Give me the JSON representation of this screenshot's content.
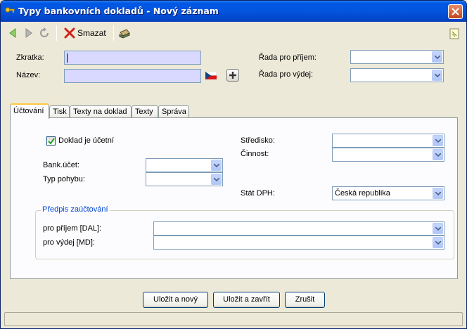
{
  "window": {
    "title": "Typy bankovních dokladů - Nový záznam"
  },
  "toolbar": {
    "delete_label": "Smazat"
  },
  "form": {
    "zkratka_label": "Zkratka:",
    "nazev_label": "Název:",
    "rada_prijem_label": "Řada pro příjem:",
    "rada_vydej_label": "Řada pro výdej:",
    "zkratka_value": "",
    "nazev_value": "",
    "rada_prijem_value": "",
    "rada_vydej_value": ""
  },
  "tabs": [
    {
      "label": "Účtování",
      "active": true
    },
    {
      "label": "Tisk"
    },
    {
      "label": "Texty na doklad"
    },
    {
      "label": "Texty"
    },
    {
      "label": "Správa"
    }
  ],
  "ucetovani": {
    "doklad_ucetni_label": "Doklad je účetní",
    "doklad_ucetni_checked": true,
    "bank_ucet_label": "Bank.účet:",
    "typ_pohybu_label": "Typ pohybu:",
    "stredisko_label": "Středisko:",
    "cinnost_label": "Činnost:",
    "stat_dph_label": "Stát DPH:",
    "stat_dph_value": "Česká republika",
    "predpis_legend": "Předpis zaúčtování",
    "prijem_dal_label": "pro příjem [DAL]:",
    "vydej_md_label": "pro výdej [MD]:"
  },
  "buttons": {
    "save_new": "Uložit a nový",
    "save_close": "Uložit a zavřít",
    "cancel": "Zrušit"
  },
  "colors": {
    "titlebar": "#0355dd",
    "input_active": "#d9d9ff",
    "group_legend": "#0046d5",
    "tab_active_border": "#ffc83c"
  }
}
